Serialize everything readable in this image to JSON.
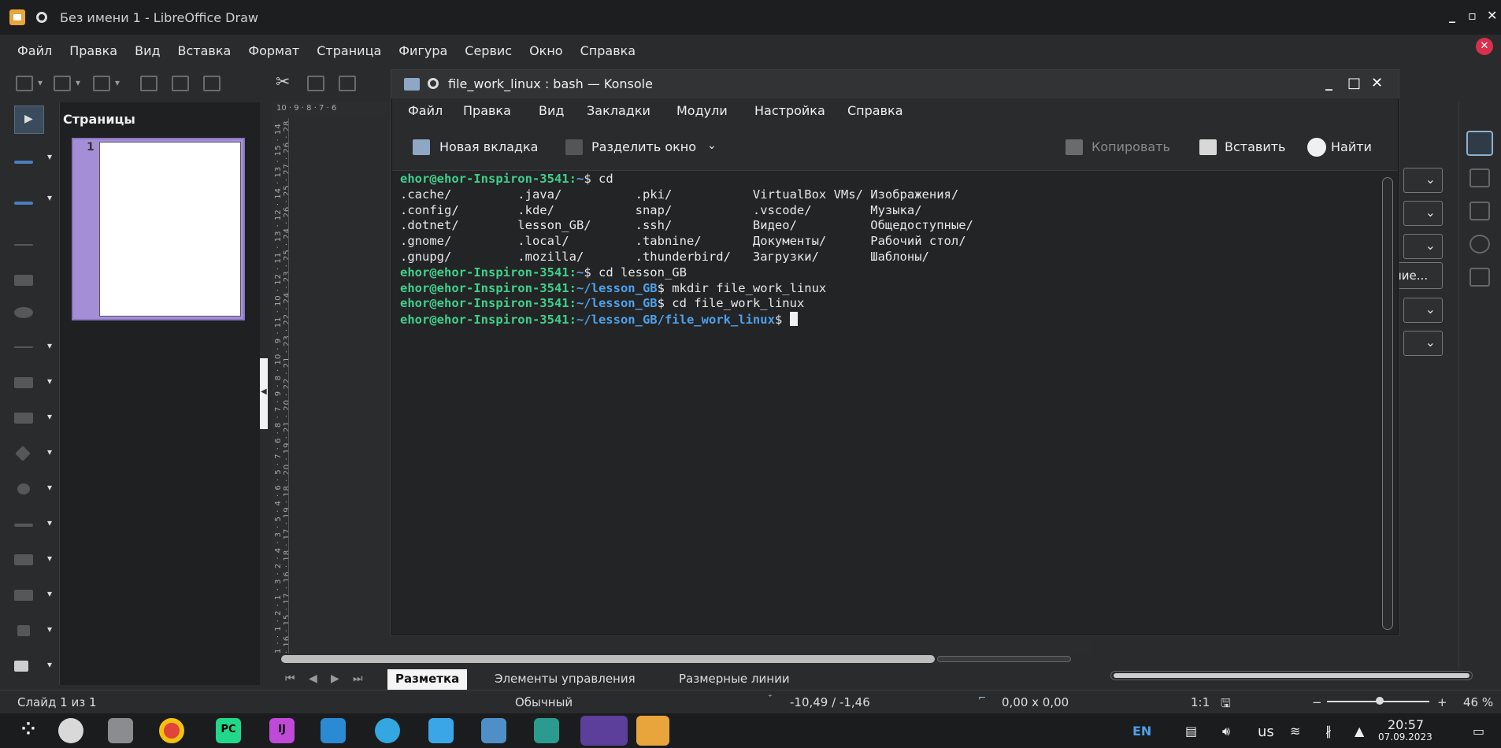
{
  "lo": {
    "title": "Без имени 1 - LibreOffice Draw",
    "menu": [
      "Файл",
      "Правка",
      "Вид",
      "Вставка",
      "Формат",
      "Страница",
      "Фигура",
      "Сервис",
      "Окно",
      "Справка"
    ],
    "pages_title": "Страницы",
    "page_number": "1",
    "ruler_h": "10 · 9 · 8 · 7 · 6",
    "ruler_v": "1 · · 1 · 2 · 1 · 3 · 2 · 4 · 3 · 5 · 4 · 6 · 5 · 7 · 6 · 8 · 7 · 9 · 8 · 10 · 9 · 11 · 10 · 12 · 11 · 13 · 12 · 14 · 13 · 15 · 14 · 16 · 15 · 17 · 16 · 18 · 17 · 19 · 18 · 20 · 19 · 21 · 20 · 22 · 21 · 23 · 22 · 24 · 23 · 25 · 24 · 26 · 25 · 27 · 26 · 28 · 27 · 29 · 28",
    "layer_tabs": [
      "Разметка",
      "Элементы управления",
      "Размерные линии"
    ],
    "sidebar_button": "ние...",
    "status": {
      "slide": "Слайд 1 из 1",
      "layout": "Обычный",
      "position": "-10,49 / -1,46",
      "size": "0,00 x 0,00",
      "scale": "1:1",
      "zoom": "46 %"
    }
  },
  "konsole": {
    "title": "file_work_linux : bash — Konsole",
    "menu": [
      "Файл",
      "Правка",
      "Вид",
      "Закладки",
      "Модули",
      "Настройка",
      "Справка"
    ],
    "toolbar": {
      "new_tab": "Новая вкладка",
      "split": "Разделить окно",
      "copy": "Копировать",
      "paste": "Вставить",
      "find": "Найти"
    },
    "prompt_user": "ehor@ehor-Inspiron-3541",
    "lines": [
      {
        "dir": "~",
        "cmd": " cd"
      },
      {
        "text": ".cache/         .java/          .pki/           VirtualBox VMs/ Изображения/"
      },
      {
        "text": ".config/        .kde/           snap/           .vscode/        Музыка/"
      },
      {
        "text": ".dotnet/        lesson_GB/      .ssh/           Видео/          Общедоступные/"
      },
      {
        "text": ".gnome/         .local/         .tabnine/       Документы/      Рабочий стол/"
      },
      {
        "text": ".gnupg/         .mozilla/       .thunderbird/   Загрузки/       Шаблоны/"
      },
      {
        "dir": "~",
        "cmd": " cd lesson_GB"
      },
      {
        "dir": "~/lesson_GB",
        "cmd": " mkdir file_work_linux"
      },
      {
        "dir": "~/lesson_GB",
        "cmd": " cd file_work_linux"
      },
      {
        "dir": "~/lesson_GB/file_work_linux",
        "cmd": " "
      }
    ]
  },
  "taskbar": {
    "lang": "EN",
    "keyboard": "us",
    "time": "20:57",
    "date": "07.09.2023"
  },
  "colors": {
    "prompt_green": "#3fd08a",
    "path_blue": "#4ea0e8",
    "page_thumb": "#a48fd7"
  }
}
